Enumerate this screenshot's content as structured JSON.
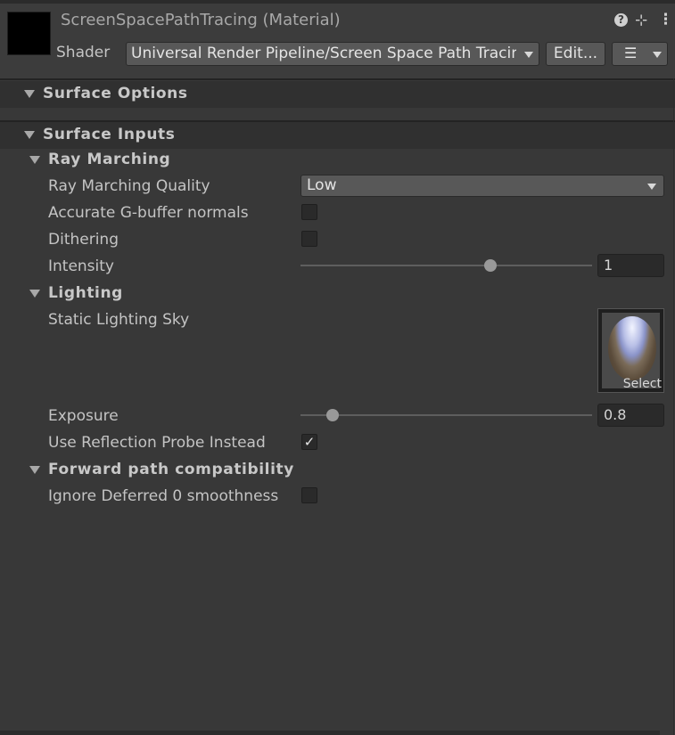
{
  "header": {
    "title": "ScreenSpacePathTracing (Material)",
    "shader_label": "Shader",
    "shader_value": "Universal Render Pipeline/Screen Space Path Tracing",
    "edit_label": "Edit...",
    "help_icon": "?"
  },
  "sections": {
    "surface_options": "Surface Options",
    "surface_inputs": "Surface Inputs"
  },
  "ray_marching": {
    "label": "Ray Marching",
    "quality_label": "Ray Marching Quality",
    "quality_value": "Low",
    "gbuffer_label": "Accurate G-buffer normals",
    "gbuffer_checked": false,
    "dithering_label": "Dithering",
    "dithering_checked": false,
    "intensity_label": "Intensity",
    "intensity_value": "1",
    "intensity_fraction": 0.65
  },
  "lighting": {
    "label": "Lighting",
    "sky_label": "Static Lighting Sky",
    "sky_select": "Select",
    "exposure_label": "Exposure",
    "exposure_value": "0.8",
    "exposure_fraction": 0.11,
    "reflection_label": "Use Reflection Probe Instead",
    "reflection_checked": true
  },
  "forward": {
    "label": "Forward path compatibility",
    "ignore_label": "Ignore Deferred 0 smoothness",
    "ignore_checked": false
  }
}
